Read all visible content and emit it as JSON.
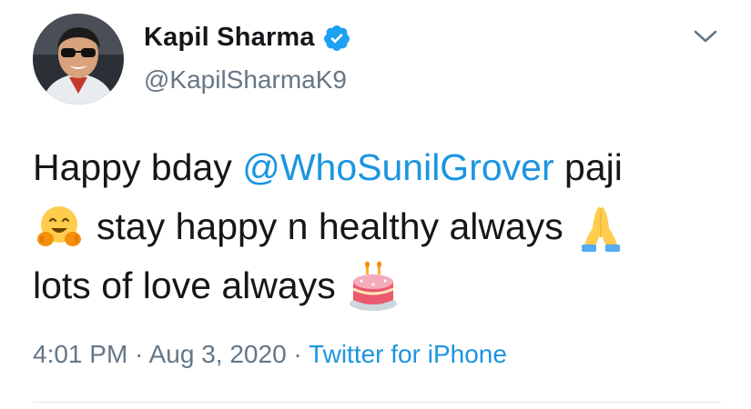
{
  "user": {
    "display_name": "Kapil Sharma",
    "handle": "@KapilSharmaK9",
    "verified": true
  },
  "tweet": {
    "line1": {
      "prefix": "Happy bday ",
      "mention": "@WhoSunilGrover",
      "suffix": " paji"
    },
    "line2": {
      "text": "stay happy n healthy always",
      "emoji_left": "hugging-face-emoji",
      "emoji_right": "folded-hands-emoji"
    },
    "line3": {
      "text": "lots of love always",
      "emoji": "birthday-cake-emoji"
    }
  },
  "meta": {
    "time": "4:01 PM",
    "separator": " · ",
    "date": "Aug 3, 2020",
    "source": "Twitter for iPhone"
  },
  "colors": {
    "text": "#14171a",
    "secondary": "#657786",
    "link": "#1b95e0",
    "verified": "#1da1f2"
  }
}
